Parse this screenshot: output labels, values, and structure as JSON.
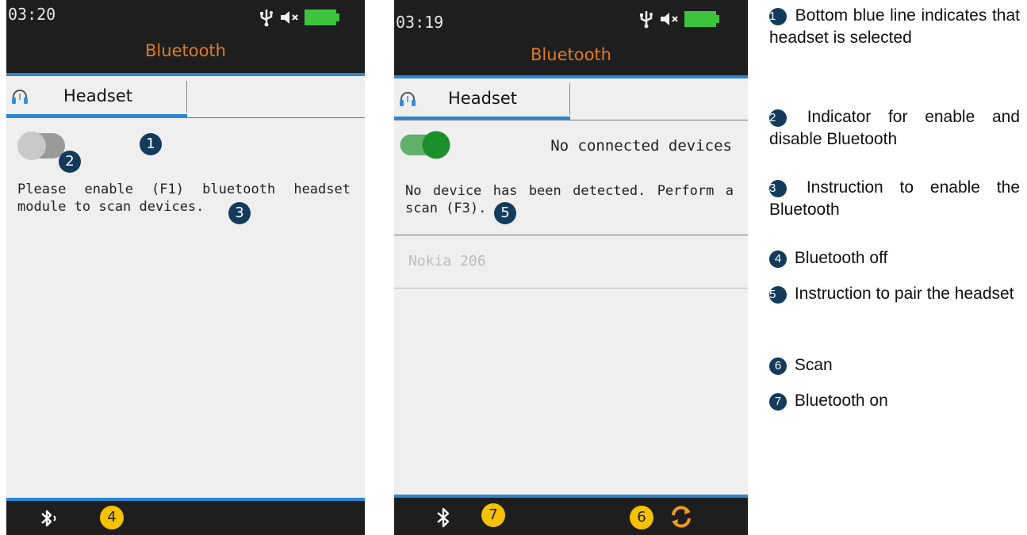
{
  "left_screen": {
    "time": "03:20",
    "title": "Bluetooth",
    "tab_label": "Headset",
    "message": "Please enable (F1) bluetooth headset module to scan devices.",
    "toggle_state": "off",
    "badges": {
      "b1": "1",
      "b2": "2",
      "b3": "3",
      "b4": "4"
    }
  },
  "right_screen": {
    "time": "03:19",
    "title": "Bluetooth",
    "tab_label": "Headset",
    "connection_status": "No connected devices",
    "message": "No device has been detected. Perform a scan (F3).",
    "toggle_state": "on",
    "devices": [
      "Nokia 206"
    ],
    "badges": {
      "b5": "5",
      "b6": "6",
      "b7": "7"
    }
  },
  "legend": [
    {
      "num": "1",
      "text": "Bottom blue line indicates that headset is selected"
    },
    {
      "num": "2",
      "text": "Indicator for enable and disable Bluetooth"
    },
    {
      "num": "3",
      "text": "Instruction to enable the Bluetooth"
    },
    {
      "num": "4",
      "text": "Bluetooth off"
    },
    {
      "num": "5",
      "text": "Instruction to pair the headset"
    },
    {
      "num": "6",
      "text": "Scan"
    },
    {
      "num": "7",
      "text": "Bluetooth on"
    }
  ],
  "colors": {
    "title_orange": "#e07a25",
    "blue_line": "#2c86d1",
    "toggle_green": "#1a8f2a",
    "badge_dark": "#123b5c",
    "badge_yellow": "#f5c100",
    "battery_green": "#3cc43c"
  },
  "icons": [
    "usb-icon",
    "mute-icon",
    "battery-icon",
    "headset-icon",
    "bluetooth-off-icon",
    "bluetooth-on-icon",
    "refresh-icon"
  ]
}
